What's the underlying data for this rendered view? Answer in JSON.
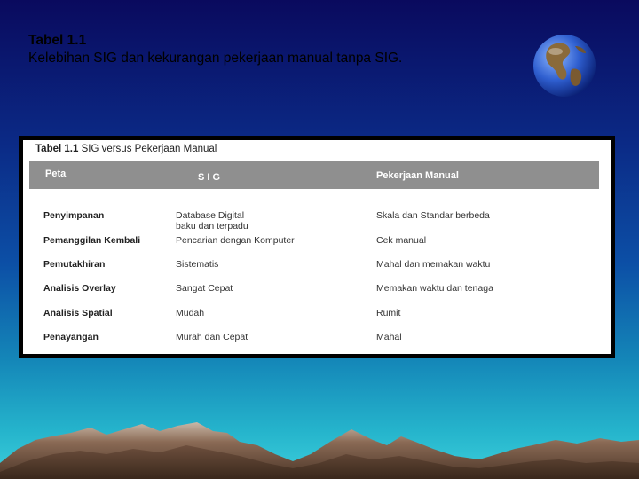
{
  "slide": {
    "title_line1": "Tabel 1.1",
    "title_line2": "Kelebihan SIG dan kekurangan pekerjaan manual tanpa SIG."
  },
  "table": {
    "caption_number": "Tabel 1.1",
    "caption_text": "SIG versus Pekerjaan Manual",
    "headers": [
      "Peta",
      "S I G",
      "Pekerjaan Manual"
    ],
    "rows": [
      {
        "label": "Penyimpanan",
        "sig": "Database Digital\nbaku dan terpadu",
        "manual": "Skala dan Standar berbeda"
      },
      {
        "label": "Pemanggilan Kembali",
        "sig": "Pencarian dengan Komputer",
        "manual": "Cek manual"
      },
      {
        "label": "Pemutakhiran",
        "sig": "Sistematis",
        "manual": "Mahal dan memakan waktu"
      },
      {
        "label": "Analisis Overlay",
        "sig": "Sangat Cepat",
        "manual": "Memakan waktu dan tenaga"
      },
      {
        "label": "Analisis Spatial",
        "sig": "Mudah",
        "manual": "Rumit"
      },
      {
        "label": "Penayangan",
        "sig": "Murah dan Cepat",
        "manual": "Mahal"
      }
    ]
  },
  "icons": {
    "globe": "globe-icon"
  },
  "colors": {
    "header_bar": "#8f8f8f",
    "background_top": "#0a0a5e",
    "background_bottom": "#3ccfdb"
  }
}
